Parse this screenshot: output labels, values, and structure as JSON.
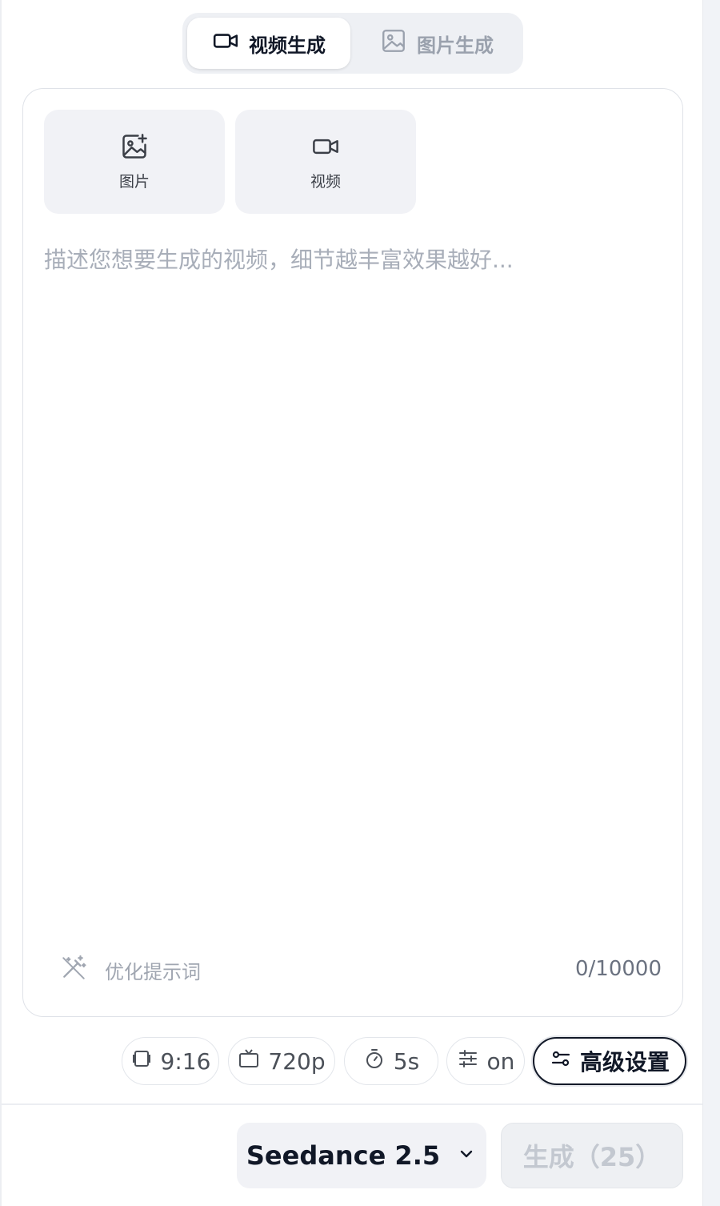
{
  "tabs": {
    "video": {
      "label": "视频生成",
      "icon": "video-camera-icon",
      "active": true
    },
    "image": {
      "label": "图片生成",
      "icon": "image-icon",
      "active": false
    }
  },
  "upload": {
    "image_label": "图片",
    "video_label": "视频"
  },
  "prompt": {
    "placeholder": "描述您想要生成的视频，细节越丰富效果越好...",
    "value": "",
    "optimize_label": "优化提示词",
    "char_count": "0/10000"
  },
  "options": {
    "aspect_ratio": "9:16",
    "resolution": "720p",
    "duration": "5s",
    "extra": "on",
    "advanced_label": "高级设置"
  },
  "footer": {
    "model": "Seedance 2.5",
    "generate_label": "生成（25）"
  },
  "colors": {
    "accent": "#111827",
    "muted": "#a8aeb9",
    "surface": "#f1f2f6"
  }
}
